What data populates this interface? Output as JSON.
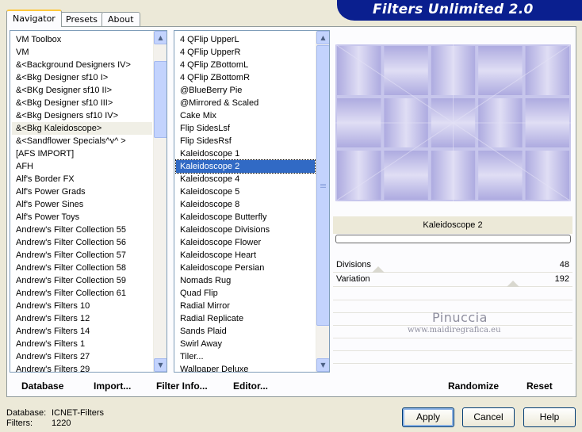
{
  "app": {
    "title": "Filters Unlimited 2.0"
  },
  "tabs": [
    {
      "label": "Navigator",
      "active": true
    },
    {
      "label": "Presets",
      "active": false
    },
    {
      "label": "About",
      "active": false
    }
  ],
  "categories": {
    "items": [
      "VM Toolbox",
      "VM",
      "&<Background Designers IV>",
      "&<Bkg Designer sf10 I>",
      "&<BKg Designer sf10 II>",
      "&<Bkg Designer sf10 III>",
      "&<Bkg Designers sf10 IV>",
      "&<Bkg Kaleidoscope>",
      "&<Sandflower Specials^v^ >",
      "[AFS IMPORT]",
      "AFH",
      "Alf's Border FX",
      "Alf's Power Grads",
      "Alf's Power Sines",
      "Alf's Power Toys",
      "Andrew's Filter Collection 55",
      "Andrew's Filter Collection 56",
      "Andrew's Filter Collection 57",
      "Andrew's Filter Collection 58",
      "Andrew's Filter Collection 59",
      "Andrew's Filter Collection 61",
      "Andrew's Filters 10",
      "Andrew's Filters 12",
      "Andrew's Filters 14",
      "Andrew's Filters 1",
      "Andrew's Filters 27",
      "Andrew's Filters 29"
    ],
    "current": "&<Bkg Kaleidoscope>"
  },
  "filters": {
    "items": [
      "4 QFlip UpperL",
      "4 QFlip UpperR",
      "4 QFlip ZBottomL",
      "4 QFlip ZBottomR",
      "@BlueBerry Pie",
      "@Mirrored & Scaled",
      "Cake Mix",
      "Flip SidesLsf",
      "Flip SidesRsf",
      "Kaleidoscope 1",
      "Kaleidoscope 2",
      "Kaleidoscope 4",
      "Kaleidoscope 5",
      "Kaleidoscope 8",
      "Kaleidoscope Butterfly",
      "Kaleidoscope Divisions",
      "Kaleidoscope Flower",
      "Kaleidoscope Heart",
      "Kaleidoscope Persian",
      "Nomads Rug",
      "Quad Flip",
      "Radial Mirror",
      "Radial Replicate",
      "Sands Plaid",
      "Swirl Away",
      "Tiler...",
      "Wallpaper Deluxe"
    ],
    "selected": "Kaleidoscope 2"
  },
  "preview": {
    "filter_name": "Kaleidoscope 2",
    "colors": {
      "light": "#e4e2f6",
      "mid": "#c7c6ec",
      "dark": "#a9a6de"
    }
  },
  "parameters": [
    {
      "label": "Divisions",
      "value": "48",
      "fraction": 0.188
    },
    {
      "label": "Variation",
      "value": "192",
      "fraction": 0.753
    }
  ],
  "watermark": {
    "name": "Pinuccia",
    "url": "www.maidiregrafica.eu"
  },
  "panel_buttons": {
    "database": "Database",
    "import": "Import...",
    "filter_info": "Filter Info...",
    "editor": "Editor...",
    "randomize": "Randomize",
    "reset": "Reset"
  },
  "status": {
    "database_label": "Database:",
    "database_value": "ICNET-Filters",
    "filters_label": "Filters:",
    "filters_value": "1220"
  },
  "buttons": {
    "apply": "Apply",
    "cancel": "Cancel",
    "help": "Help"
  }
}
